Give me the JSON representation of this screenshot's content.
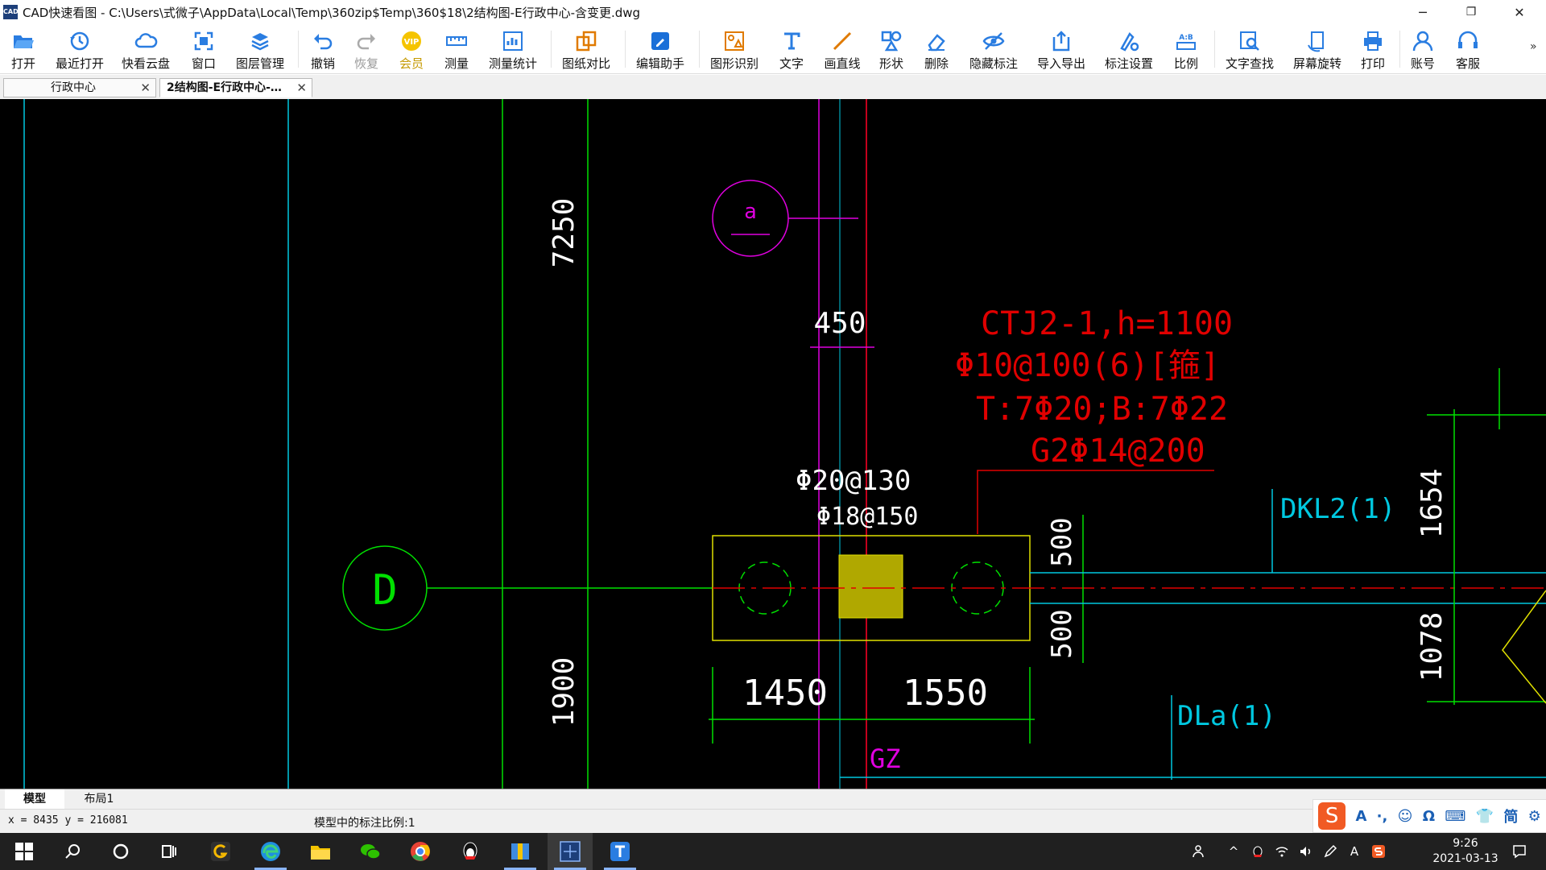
{
  "window": {
    "title": "CAD快速看图 - C:\\Users\\式微子\\AppData\\Local\\Temp\\360zip$Temp\\360$18\\2结构图-E行政中心-含变更.dwg",
    "app_icon_text": "CAD",
    "minimize": "─",
    "maximize": "❐",
    "close": "✕"
  },
  "toolbar": {
    "open": "打开",
    "recent": "最近打开",
    "cloud": "快看云盘",
    "window": "窗口",
    "layers": "图层管理",
    "undo": "撤销",
    "redo": "恢复",
    "member": "会员",
    "measure": "测量",
    "measure_stats": "测量统计",
    "compare": "图纸对比",
    "edit_helper": "编辑助手",
    "shape_recog": "图形识别",
    "text": "文字",
    "line": "画直线",
    "shape": "形状",
    "delete": "删除",
    "hide_annot": "隐藏标注",
    "import_export": "导入导出",
    "annot_settings": "标注设置",
    "ratio": "比例",
    "text_search": "文字查找",
    "screen_rotate": "屏幕旋转",
    "print": "打印",
    "account": "账号",
    "service": "客服",
    "overflow": "»",
    "vip_badge": "VIP",
    "ratio_badge": "A:B"
  },
  "tabs": [
    {
      "label": "行政中心",
      "close": "✕"
    },
    {
      "label": "2结构图-E行政中心-…",
      "close": "✕"
    }
  ],
  "drawing": {
    "axis_a": "a",
    "axis_d": "D",
    "dim_7250": "7250",
    "dim_1900": "1900",
    "dim_450": "450",
    "dim_500_top": "500",
    "dim_500_bottom": "500",
    "dim_1450": "1450",
    "dim_1550": "1550",
    "dim_1654": "1654",
    "dim_1078": "1078",
    "ctj": "CTJ2-1,h=1100",
    "stirrup": "Φ10@100(6)[箍]",
    "rebar_tb": "T:7Φ20;B:7Φ22",
    "side_rebar": "G2Φ14@200",
    "rebar_130": "Φ20@130",
    "rebar_150": "Φ18@150",
    "dkl": "DKL2(1)",
    "dla": "DLa(1)",
    "gz": "GZ",
    "colors": {
      "magenta": "#e000e0",
      "green": "#00e000",
      "red": "#e00000",
      "yellow": "#e0e000",
      "cyan": "#00c8e0",
      "white": "#ffffff"
    }
  },
  "layout_tabs": [
    "模型",
    "布局1"
  ],
  "status": {
    "coords": "x = 8435  y = 216081",
    "scale": "模型中的标注比例:1"
  },
  "ime": {
    "logo": "S",
    "items": [
      "A",
      "·,",
      "☺",
      "Ω",
      "⌨",
      "👕",
      "简",
      "⚙"
    ]
  },
  "taskbar": {
    "clock_time": "9:26",
    "clock_date": "2021-03-13",
    "tray_a": "A",
    "tray_chevron": "^"
  }
}
